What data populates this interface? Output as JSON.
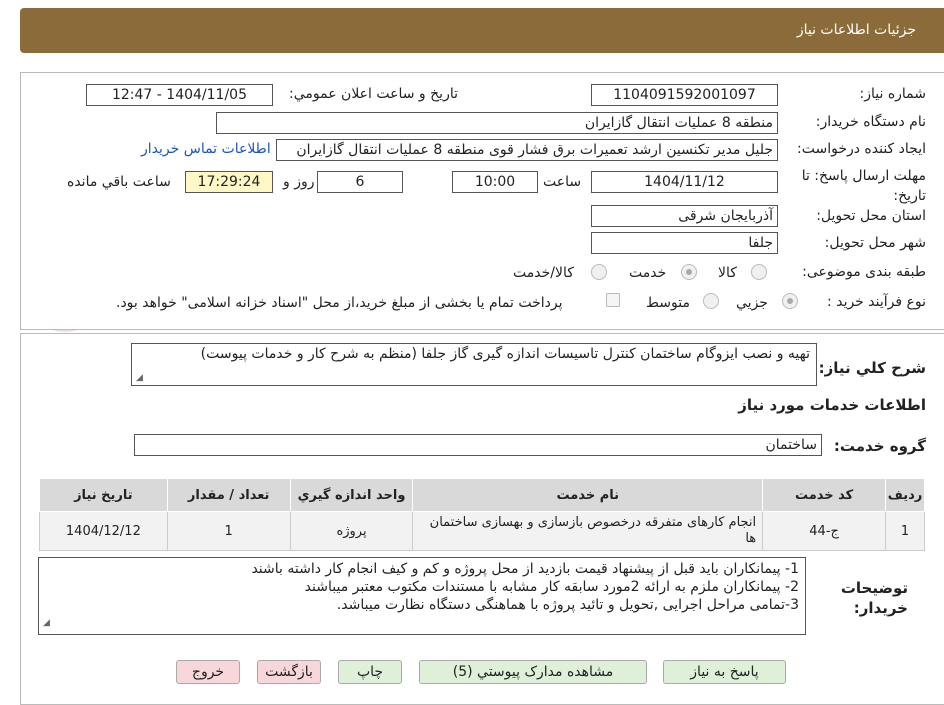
{
  "header": {
    "title": "جزئیات اطلاعات نیاز"
  },
  "fields": {
    "need_number_label": "شماره نیاز:",
    "need_number": "1104091592001097",
    "announce_label": "تاریخ و ساعت اعلان عمومي:",
    "announce_value": "1404/11/05 - 12:47",
    "buyer_org_label": "نام دستگاه خريدار:",
    "buyer_org": "منطقه 8 عملیات انتقال گازایران",
    "creator_label": "ايجاد کننده درخواست:",
    "creator": "جلیل مدیر تکنسین ارشد تعمیرات برق فشار قوی منطقه 8 عملیات انتقال گازایران",
    "contact_link": "اطلاعات تماس خریدار",
    "deadline_label": "مهلت ارسال پاسخ: تا تاریخ:",
    "deadline_date": "1404/11/12",
    "hour_label": "ساعت",
    "deadline_time": "10:00",
    "days": "6",
    "days_label": "روز و",
    "remaining": "17:29:24",
    "remaining_label": "ساعت باقي مانده",
    "province_label": "استان محل تحويل:",
    "province": "آذربایجان شرقی",
    "city_label": "شهر محل تحويل:",
    "city": "جلفا",
    "category_label": "طبقه بندی موضوعی:",
    "cat_goods": "کالا",
    "cat_service": "خدمت",
    "cat_goods_service": "کالا/خدمت",
    "process_label": "نوع فرآيند خريد :",
    "proc_partial": "جزيي",
    "proc_medium": "متوسط",
    "payment_note": "پرداخت تمام یا بخشی از مبلغ خرید،از محل \"اسناد خزانه اسلامی\" خواهد بود."
  },
  "description": {
    "label": "شرح کلي نياز:",
    "text": "تهیه و نصب ایزوگام ساختمان کنترل تاسیسات اندازه گیری گاز جلفا (منظم به شرح کار و خدمات پیوست)"
  },
  "services": {
    "section_title": "اطلاعات خدمات مورد نياز",
    "group_label": "گروه خدمت:",
    "group_value": "ساختمان",
    "columns": [
      "رديف",
      "کد خدمت",
      "نام خدمت",
      "واحد اندازه گيري",
      "تعداد / مقدار",
      "تاريخ نياز"
    ],
    "rows": [
      {
        "row": "1",
        "code": "ج-44",
        "name": "انجام کارهای متفرقه درخصوص بازسازی و بهسازی ساختمان ها",
        "unit": "پروژه",
        "qty": "1",
        "date": "1404/12/12"
      }
    ]
  },
  "notes": {
    "label": "توضيحات خريدار:",
    "line1": "1- پیمانکاران باید قبل از پیشنهاد قیمت بازدید از محل پروژه و کم و کیف انجام کار داشته باشند",
    "line2": "2- پیمانکاران ملزم به ارائه 2مورد سابقه کار مشابه با مستندات مکتوب معتبر میباشند",
    "line3": "3-تمامی مراحل اجرایی ,تحویل و تائید پروژه با هماهنگی دستگاه نظارت میباشد."
  },
  "buttons": {
    "reply": "پاسخ به نیاز",
    "attachments": "مشاهده مدارک پیوستي (5)",
    "print": "چاپ",
    "back": "بازگشت",
    "exit": "خروج"
  }
}
